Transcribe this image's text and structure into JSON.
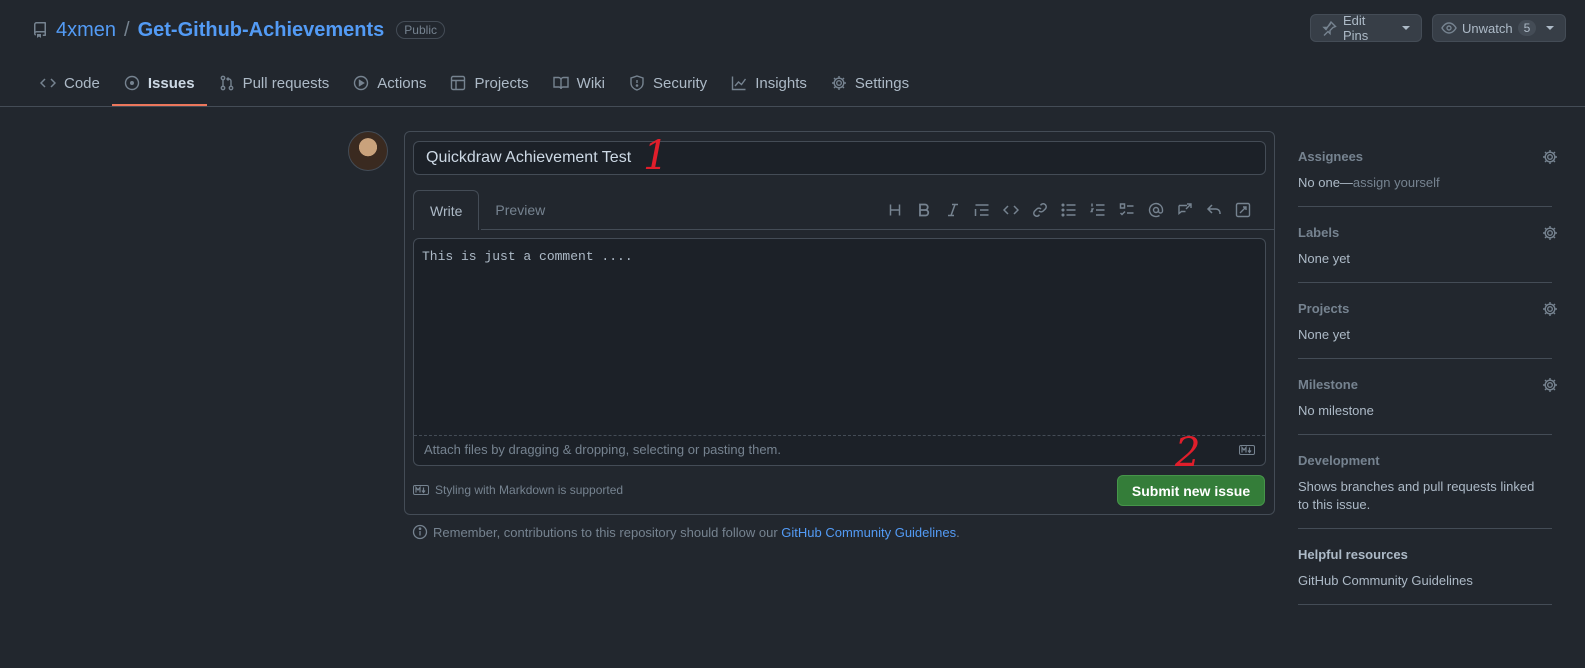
{
  "repo": {
    "owner": "4xmen",
    "separator": "/",
    "name": "Get-Github-Achievements",
    "visibility": "Public"
  },
  "header_buttons": {
    "edit_pins": "Edit Pins",
    "unwatch": "Unwatch",
    "watch_count": "5"
  },
  "tabs": [
    {
      "label": "Code",
      "icon": "code-icon"
    },
    {
      "label": "Issues",
      "icon": "issue-icon",
      "active": true
    },
    {
      "label": "Pull requests",
      "icon": "pull-request-icon"
    },
    {
      "label": "Actions",
      "icon": "play-icon"
    },
    {
      "label": "Projects",
      "icon": "table-icon"
    },
    {
      "label": "Wiki",
      "icon": "book-icon"
    },
    {
      "label": "Security",
      "icon": "shield-icon"
    },
    {
      "label": "Insights",
      "icon": "graph-icon"
    },
    {
      "label": "Settings",
      "icon": "gear-icon"
    }
  ],
  "issue_form": {
    "title_value": "Quickdraw Achievement Test",
    "write_tab": "Write",
    "preview_tab": "Preview",
    "body_value": "This is just a comment ....",
    "attach_hint": "Attach files by dragging & dropping, selecting or pasting them.",
    "markdown_note": "Styling with Markdown is supported",
    "submit_label": "Submit new issue",
    "remember_text": "Remember, contributions to this repository should follow our ",
    "guidelines_link": "GitHub Community Guidelines",
    "remember_end": "."
  },
  "annotations": {
    "one": "1",
    "two": "2"
  },
  "sidebar": {
    "assignees": {
      "heading": "Assignees",
      "value_prefix": "No one—",
      "value_link": "assign yourself"
    },
    "labels": {
      "heading": "Labels",
      "value": "None yet"
    },
    "projects": {
      "heading": "Projects",
      "value": "None yet"
    },
    "milestone": {
      "heading": "Milestone",
      "value": "No milestone"
    },
    "development": {
      "heading": "Development",
      "value": "Shows branches and pull requests linked to this issue."
    },
    "helpful": {
      "heading": "Helpful resources",
      "link": "GitHub Community Guidelines"
    }
  },
  "colors": {
    "accent": "#539bf5",
    "submit": "#347d39",
    "tab_underline": "#ec775c",
    "annotation": "#e01e2b"
  }
}
